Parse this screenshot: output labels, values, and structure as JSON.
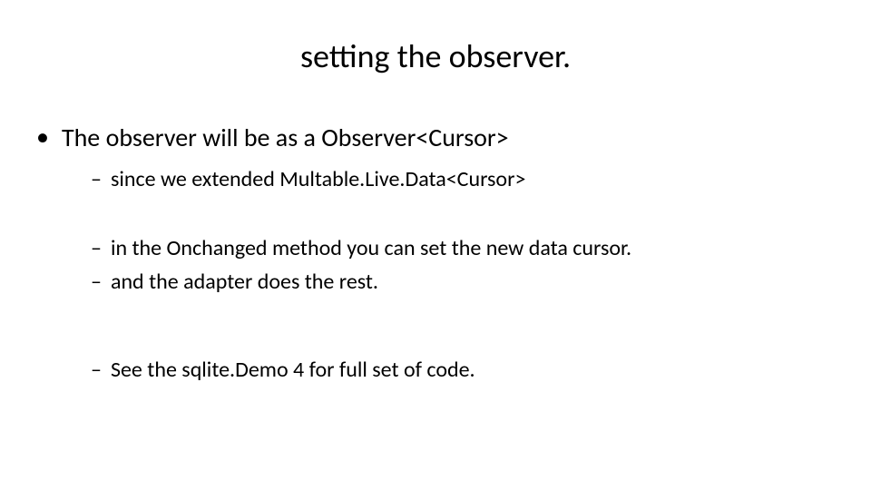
{
  "slide": {
    "title": "setting the observer.",
    "bullet1": "The observer  will be as a Observer<Cursor>",
    "sub1": "since we extended Multable.Live.Data<Cursor>",
    "sub2": "in the Onchanged method you can set the new data cursor.",
    "sub3": "and the adapter does the rest.",
    "sub4": "See the sqlite.Demo 4 for full set of code."
  }
}
